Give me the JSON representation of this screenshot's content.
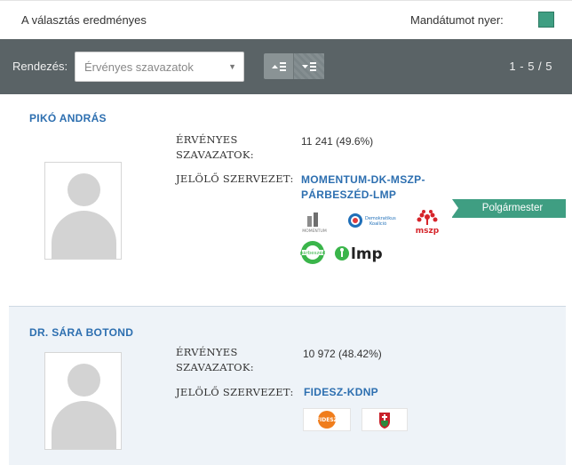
{
  "header": {
    "title": "A választás eredményes",
    "legend_label": "Mandátumot nyer:",
    "legend_color": "#3f9e82"
  },
  "toolbar": {
    "sort_label": "Rendezés:",
    "sort_value": "Érvényes szavazatok",
    "sort_options_visible": [
      "Érvényes szavazatok"
    ],
    "buttons": [
      {
        "icon": "sort-ascending-icon",
        "glyph": "▲≡"
      },
      {
        "icon": "sort-descending-icon",
        "glyph": "▼≡"
      }
    ],
    "pagination": "1 - 5 / 5"
  },
  "candidates": [
    {
      "name": "PIKÓ ANDRÁS",
      "votes_label": "ÉRVÉNYES SZAVAZATOK:",
      "votes": "11 241 (49.6%)",
      "nominator_label": "JELÖLŐ SZERVEZET:",
      "nominator": "MOMENTUM-DK-MSZP-PÁRBESZÉD-LMP",
      "badge": "Polgármester",
      "logos": [
        {
          "icon": "momentum-logo",
          "text": "MOMENTUM"
        },
        {
          "icon": "dk-logo",
          "text": "Demokratikus Koalíció"
        },
        {
          "icon": "mszp-logo",
          "text": "mszp"
        },
        {
          "icon": "parbeszed-logo",
          "text": "párbeszéd"
        },
        {
          "icon": "lmp-logo",
          "text": "lmp"
        }
      ]
    },
    {
      "name": "DR. SÁRA BOTOND",
      "votes_label": "ÉRVÉNYES SZAVAZATOK:",
      "votes": "10 972 (48.42%)",
      "nominator_label": "JELÖLŐ SZERVEZET:",
      "nominator": "FIDESZ-KDNP",
      "logos": [
        {
          "icon": "fidesz-logo",
          "text": "FIDESZ"
        },
        {
          "icon": "kdnp-logo",
          "text": "KDNP"
        }
      ]
    }
  ]
}
